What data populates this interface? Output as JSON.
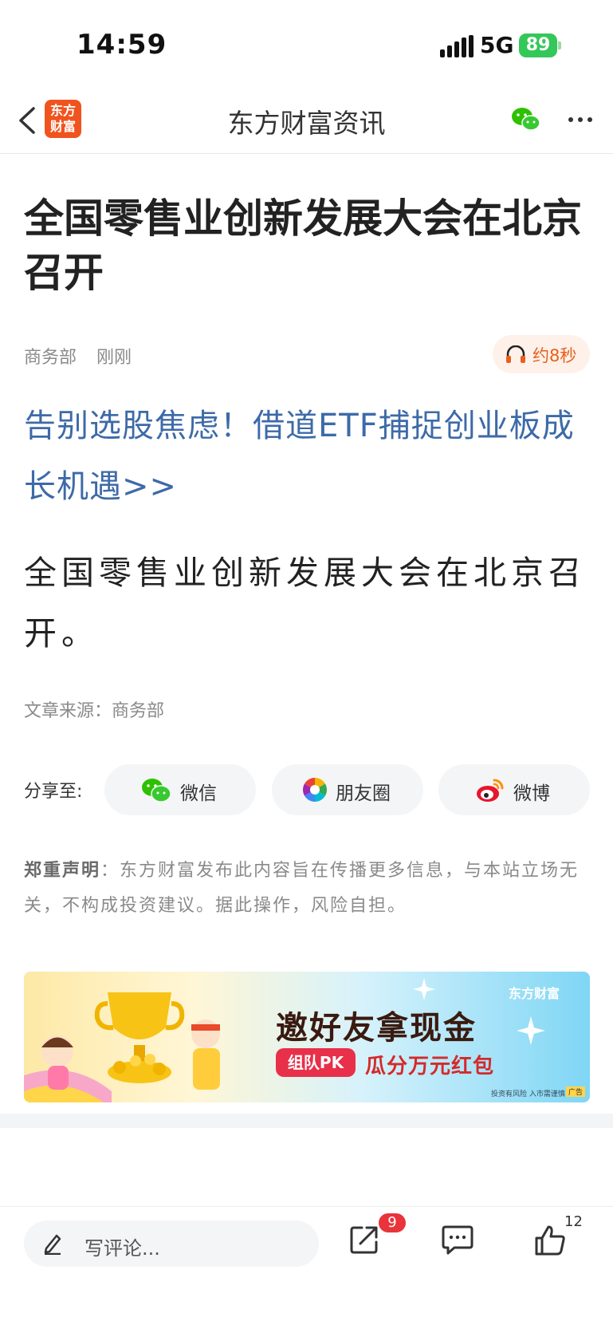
{
  "status_bar": {
    "time": "14:59",
    "network": "5G",
    "battery": "89"
  },
  "nav": {
    "logo_line1": "东方",
    "logo_line2": "财富",
    "title": "东方财富资讯"
  },
  "article": {
    "title": "全国零售业创新发展大会在北京召开",
    "source": "商务部",
    "time": "刚刚",
    "listen_duration": "约8秒",
    "promo_link": "告别选股焦虑！借道ETF捕捉创业板成长机遇>>",
    "body": "全国零售业创新发展大会在北京召开。",
    "source_line": "文章来源：商务部"
  },
  "share": {
    "label": "分享至:",
    "options": [
      "微信",
      "朋友圈",
      "微博"
    ]
  },
  "disclaimer": {
    "label": "郑重声明",
    "text": "：东方财富发布此内容旨在传播更多信息，与本站立场无关，不构成投资建议。据此操作，风险自担。"
  },
  "banner": {
    "brand": "东方财富",
    "headline": "邀好友拿现金",
    "tag": "组队PK",
    "subline": "瓜分万元红包",
    "risk": "投资有风险 入市需谨慎",
    "ad_label": "广告"
  },
  "bottom_bar": {
    "comment_placeholder": "写评论...",
    "share_count": "9",
    "like_count": "12"
  }
}
